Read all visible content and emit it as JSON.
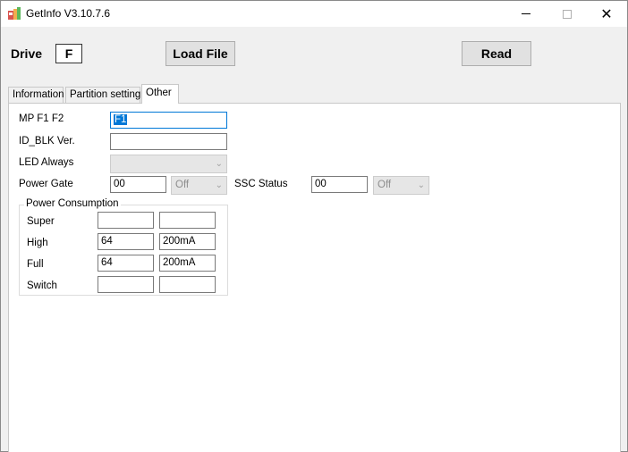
{
  "window": {
    "title": "GetInfo V3.10.7.6",
    "minimize_icon": "minimize-icon",
    "maximize_icon": "maximize-icon",
    "close_icon": "close-icon",
    "close_glyph": "✕"
  },
  "toolbar": {
    "drive_label": "Drive",
    "drive_value": "F",
    "load_file_label": "Load File",
    "read_label": "Read"
  },
  "tabs": [
    {
      "label": "Information",
      "selected": false
    },
    {
      "label": "Partition setting",
      "selected": false
    },
    {
      "label": "Other",
      "selected": true
    }
  ],
  "other": {
    "mp_label": "MP F1 F2",
    "mp_value": "F1",
    "id_blk_label": "ID_BLK Ver.",
    "id_blk_value": "",
    "led_label": "LED Always",
    "led_value": "",
    "power_gate_label": "Power Gate",
    "power_gate_value": "00",
    "power_gate_mode": "Off",
    "ssc_label": "SSC Status",
    "ssc_value": "00",
    "ssc_mode": "Off",
    "dropdown_arrow": "⌄"
  },
  "power_consumption": {
    "title": "Power Consumption",
    "rows": [
      {
        "label": "Super",
        "value": "",
        "current": ""
      },
      {
        "label": "High",
        "value": "64",
        "current": "200mA"
      },
      {
        "label": "Full",
        "value": "64",
        "current": "200mA"
      },
      {
        "label": "Switch",
        "value": "",
        "current": ""
      }
    ]
  },
  "colors": {
    "focus": "#0078d7",
    "panel": "#ffffff",
    "window": "#f0f0f0"
  }
}
